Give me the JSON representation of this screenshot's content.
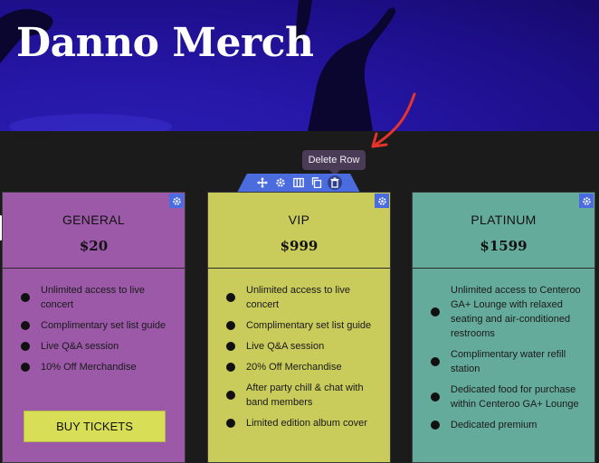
{
  "hero": {
    "title": "Danno Merch"
  },
  "row_toolbar": {
    "tooltip": "Delete Row",
    "buttons": [
      "move-icon",
      "gear-icon",
      "columns-icon",
      "duplicate-icon",
      "trash-icon"
    ]
  },
  "colors": {
    "hero_bg": "#2617a8",
    "general": "#9b59a8",
    "vip": "#c9cb5b",
    "platinum": "#65ab9b",
    "editor_accent": "#4a6cde",
    "annotation_arrow": "#e8332a"
  },
  "cards": [
    {
      "name": "GENERAL",
      "price": "$20",
      "features": [
        "Unlimited access to live concert",
        "Complimentary set list guide",
        "Live Q&A session",
        "10% Off Merchandise"
      ],
      "button": "BUY TICKETS"
    },
    {
      "name": "VIP",
      "price": "$999",
      "features": [
        "Unlimited access to live concert",
        "Complimentary set list guide",
        "Live Q&A session",
        "20% Off Merchandise",
        "After party chill & chat with band members",
        "Limited edition album cover"
      ]
    },
    {
      "name": "PLATINUM",
      "price": "$1599",
      "features": [
        "Unlimited access to Centeroo GA+ Lounge with relaxed seating and air-conditioned restrooms",
        "Complimentary water refill station",
        "Dedicated food for purchase within Centeroo GA+ Lounge",
        "Dedicated premium"
      ]
    }
  ]
}
